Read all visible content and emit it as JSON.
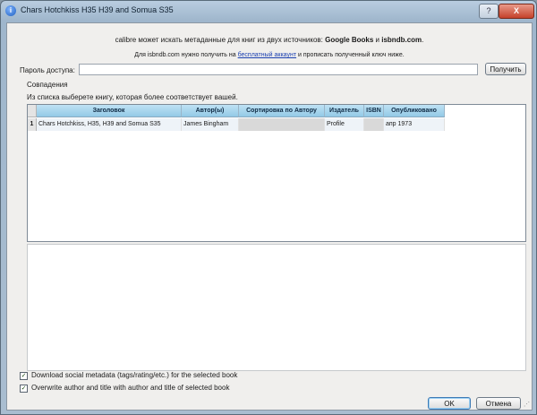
{
  "window": {
    "title": "Chars Hotchkiss H35 H39 and Somua S35",
    "help_label": "?",
    "close_label": "X"
  },
  "intro": {
    "text_before": "calibre может искать метаданные для книг из двух источников: ",
    "source1": "Google Books",
    "text_mid": " и ",
    "source2": "isbndb.com",
    "text_end": "."
  },
  "key_note": {
    "before": "Для isbndb.com нужно получить на ",
    "link": "бесплатный аккаунт",
    "after": " и прописать полученный ключ ниже."
  },
  "password": {
    "label": "Пароль доступа:",
    "value": "",
    "get_button": "Получить"
  },
  "matches": {
    "legend": "Совпадения",
    "hint": "Из списка выберете книгу, которая более соответствует вашей.",
    "columns": [
      "Заголовок",
      "Автор(ы)",
      "Сортировка по Автору",
      "Издатель",
      "ISBN",
      "Опубликовано"
    ],
    "rows": [
      {
        "num": "1",
        "cells": [
          "Chars Hotchkiss, H35, H39 and Somua S35",
          "James Bingham",
          "",
          "Profile",
          "",
          "апр 1973"
        ]
      }
    ]
  },
  "options": {
    "social": {
      "label": "Download social metadata (tags/rating/etc.) for the selected book",
      "checked": true
    },
    "overwrite": {
      "label": "Overwrite author and title with author and title of selected book",
      "checked": true
    }
  },
  "buttons": {
    "ok": "OK",
    "cancel": "Отмена"
  }
}
